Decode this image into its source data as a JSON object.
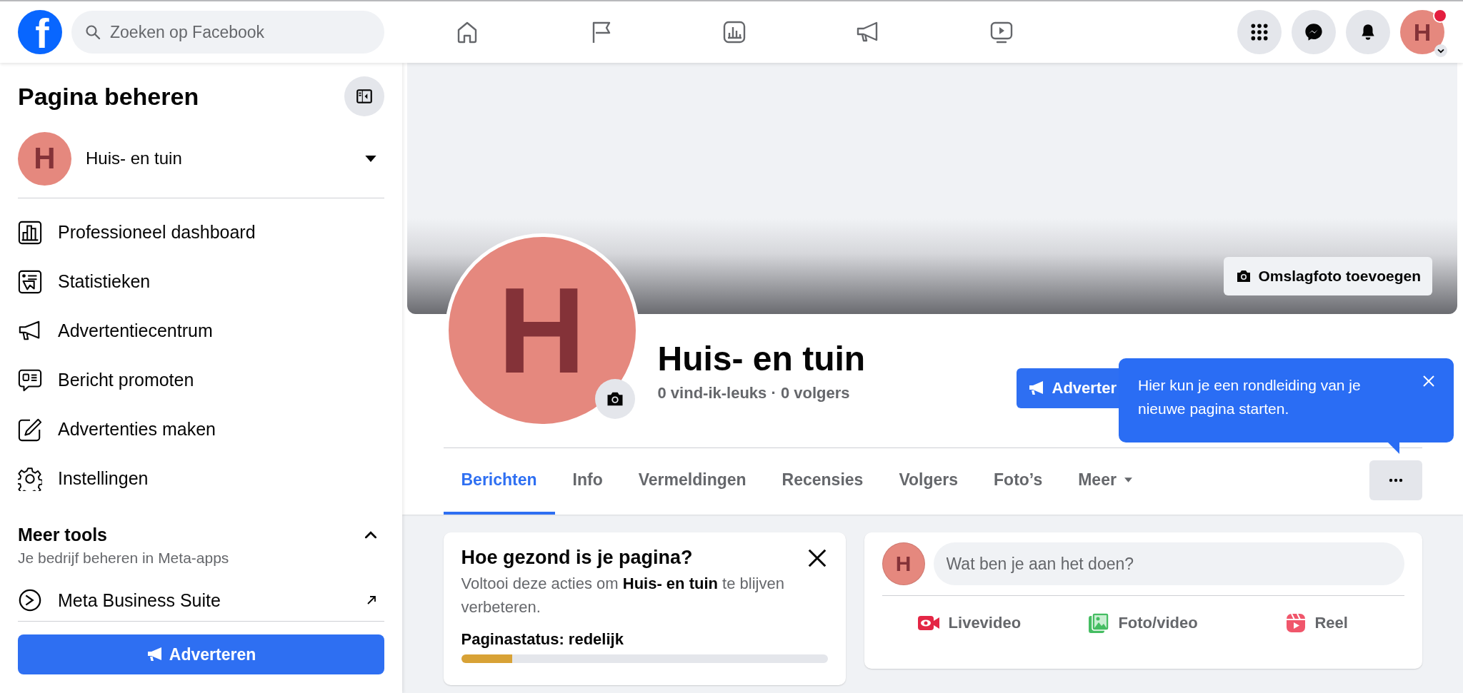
{
  "topbar": {
    "logo": "f",
    "search": {
      "placeholder": "Zoeken op Facebook"
    },
    "account": {
      "initial": "H",
      "notification": true
    }
  },
  "sidebar": {
    "title": "Pagina beheren",
    "page": {
      "initial": "H",
      "name": "Huis- en tuin"
    },
    "menu": [
      {
        "label": "Professioneel dashboard"
      },
      {
        "label": "Statistieken"
      },
      {
        "label": "Advertentiecentrum"
      },
      {
        "label": "Bericht promoten"
      },
      {
        "label": "Advertenties maken"
      },
      {
        "label": "Instellingen"
      }
    ],
    "more_tools": {
      "title": "Meer tools",
      "subtitle": "Je bedrijf beheren in Meta-apps",
      "expanded": true,
      "items": [
        {
          "label": "Meta Business Suite"
        }
      ]
    },
    "button": "Adverteren"
  },
  "page_header": {
    "cover_button": "Omslagfoto toevoegen",
    "initial": "H",
    "name": "Huis- en tuin",
    "stats": "0 vind-ik-leuks · 0 volgers",
    "promote_button": "Adverter",
    "tooltip": {
      "text": "Hier kun je een rondleiding van je nieuwe pagina starten."
    },
    "tabs": [
      {
        "label": "Berichten",
        "selected": true
      },
      {
        "label": "Info",
        "selected": false
      },
      {
        "label": "Vermeldingen",
        "selected": false
      },
      {
        "label": "Recensies",
        "selected": false
      },
      {
        "label": "Volgers",
        "selected": false
      },
      {
        "label": "Foto’s",
        "selected": false
      },
      {
        "label": "Meer",
        "selected": false,
        "dropdown": true
      }
    ]
  },
  "health_card": {
    "title": "Hoe gezond is je pagina?",
    "text": "Voltooi deze acties om **Huis- en tuin** te blijven verbeteren.",
    "status": "Paginastatus: redelijk",
    "level": 0.14
  },
  "composer": {
    "initial": "H",
    "placeholder": "Wat ben je aan het doen?",
    "actions": [
      {
        "label": "Livevideo"
      },
      {
        "label": "Foto/video"
      },
      {
        "label": "Reel"
      }
    ]
  }
}
